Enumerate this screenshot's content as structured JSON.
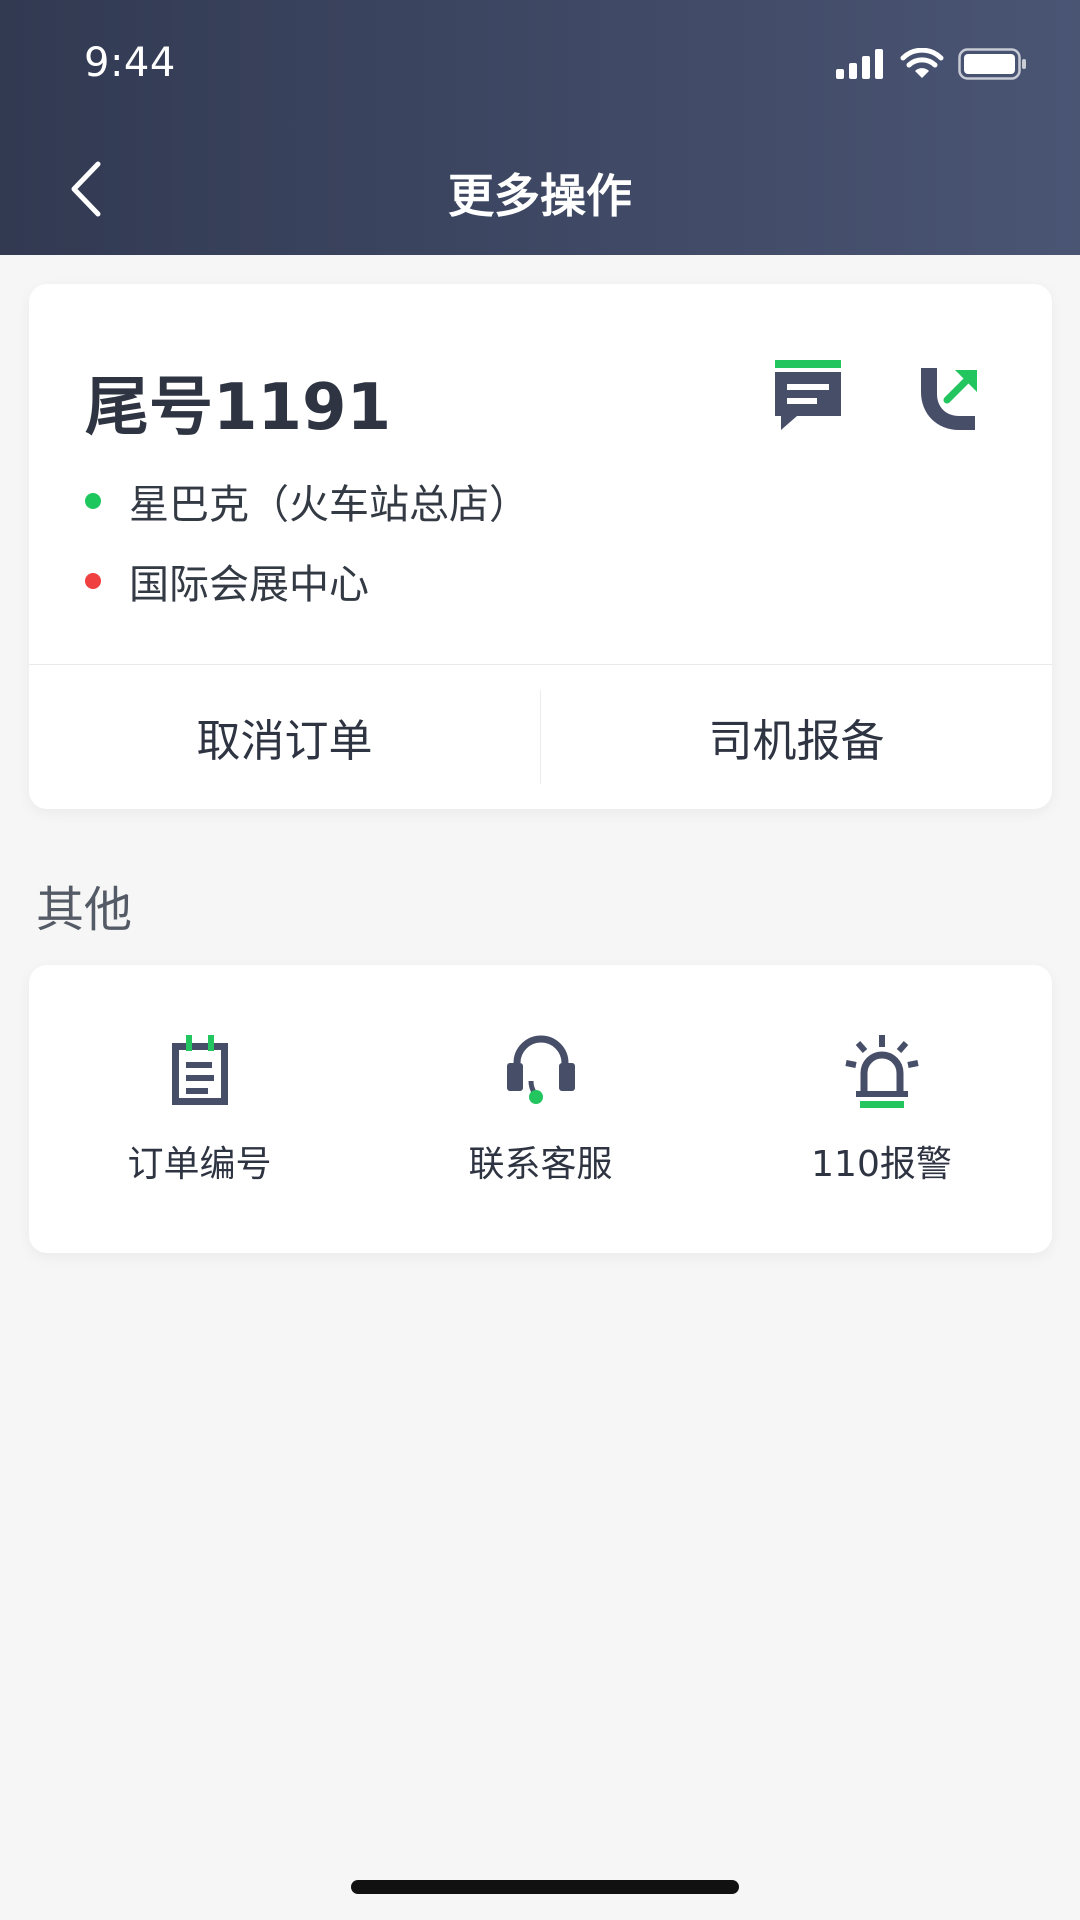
{
  "status_bar": {
    "time": "9:44",
    "icons": [
      "signal-icon",
      "wifi-icon",
      "battery-icon"
    ]
  },
  "nav": {
    "back_icon": "chevron-left-icon",
    "title": "更多操作"
  },
  "order": {
    "plate": "尾号1191",
    "start": "星巴克（火车站总店）",
    "end": "国际会展中心",
    "message_icon": "message-icon",
    "call_icon": "phone-call-icon",
    "actions": {
      "cancel": "取消订单",
      "report": "司机报备"
    }
  },
  "other": {
    "section_title": "其他",
    "tools": [
      {
        "label": "订单编号",
        "icon": "order-number-icon"
      },
      {
        "label": "联系客服",
        "icon": "customer-service-icon"
      },
      {
        "label": "110报警",
        "icon": "alarm-icon"
      }
    ]
  },
  "colors": {
    "header_start": "#323a52",
    "header_end": "#4a5574",
    "accent_green": "#22c55e",
    "dot_green": "#1ec65e",
    "dot_red": "#f04040",
    "icon_dark": "#474e68",
    "background": "#f6f6f6"
  }
}
